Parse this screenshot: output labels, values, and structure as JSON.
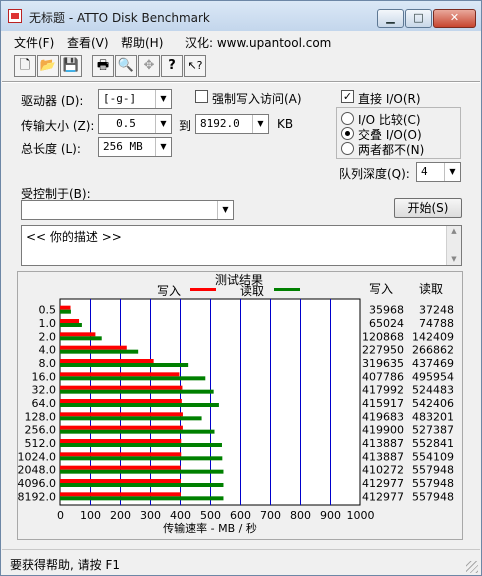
{
  "window": {
    "title": "无标题 - ATTO Disk Benchmark",
    "controls": {
      "minimize": "▁",
      "maximize": "□",
      "close": "✕"
    }
  },
  "menu": [
    "文件(F)",
    "查看(V)",
    "帮助(H)",
    "汉化: www.upantool.com"
  ],
  "toolbar": {
    "icons": [
      "new-file-icon",
      "open-folder-icon",
      "save-icon",
      "print-icon",
      "print-preview-icon",
      "move-icon",
      "help-icon",
      "context-help-icon"
    ],
    "glyphs": [
      "🗋",
      "📂",
      "💾",
      "🖶",
      "🔍",
      "✥",
      "?",
      "↖?"
    ]
  },
  "form": {
    "drive_label": "驱动器 (D):",
    "drive_value": "[-g-]",
    "force_write_label": "强制写入访问(A)",
    "force_write_checked": false,
    "direct_io_label": "直接 I/O(R)",
    "direct_io_checked": true,
    "transfer_label": "传输大小 (Z):",
    "transfer_from": "0.5",
    "transfer_to_label": "到",
    "transfer_to": "8192.0",
    "transfer_unit": "KB",
    "total_length_label": "总长度 (L):",
    "total_length_value": "256 MB",
    "io_compare_label": "I/O 比较(C)",
    "overlapped_io_label": "交叠 I/O(O)",
    "neither_label": "两者都不(N)",
    "io_mode_selected": "overlapped",
    "queue_depth_label": "队列深度(Q):",
    "queue_depth_value": "4",
    "controlled_by_label": "受控制于(B):",
    "controlled_by_value": "",
    "start_button": "开始(S)",
    "description_text": "<<  你的描述    >>"
  },
  "results": {
    "title": "测试结果",
    "legend_write": "写入",
    "legend_read": "读取",
    "col_write": "写入",
    "col_read": "读取"
  },
  "chart_data": {
    "type": "bar",
    "orientation": "horizontal",
    "title": "测试结果",
    "xlabel": "传输速率 - MB / 秒",
    "ylabel": "",
    "xlim": [
      0,
      1000
    ],
    "xticks": [
      0,
      100,
      200,
      300,
      400,
      500,
      600,
      700,
      800,
      900,
      1000
    ],
    "grid": true,
    "legend_placement": "top",
    "categories": [
      "0.5",
      "1.0",
      "2.0",
      "4.0",
      "8.0",
      "16.0",
      "32.0",
      "64.0",
      "128.0",
      "256.0",
      "512.0",
      "1024.0",
      "2048.0",
      "4096.0",
      "8192.0"
    ],
    "series": [
      {
        "name": "写入",
        "color": "#ff0000",
        "values": [
          35.1,
          63.5,
          118.0,
          222.6,
          312.1,
          398.2,
          408.2,
          406.2,
          409.8,
          409.7,
          404.2,
          404.2,
          402.6,
          403.3,
          403.3
        ]
      },
      {
        "name": "读取",
        "color": "#008000",
        "values": [
          36.4,
          73.0,
          139.1,
          260.6,
          427.2,
          484.3,
          512.2,
          529.7,
          471.9,
          515.0,
          539.9,
          541.1,
          544.9,
          544.9,
          544.9
        ]
      }
    ],
    "table": {
      "write": [
        "35968",
        "65024",
        "120868",
        "227950",
        "319635",
        "407786",
        "417992",
        "415917",
        "419683",
        "419900",
        "413887",
        "413887",
        "410272",
        "412977",
        "412977"
      ],
      "read": [
        "37248",
        "74788",
        "142409",
        "266862",
        "437469",
        "495954",
        "524483",
        "542406",
        "483201",
        "527387",
        "552841",
        "554109",
        "557948",
        "557948",
        "557948"
      ]
    }
  },
  "status": {
    "text": "要获得帮助, 请按 F1"
  }
}
